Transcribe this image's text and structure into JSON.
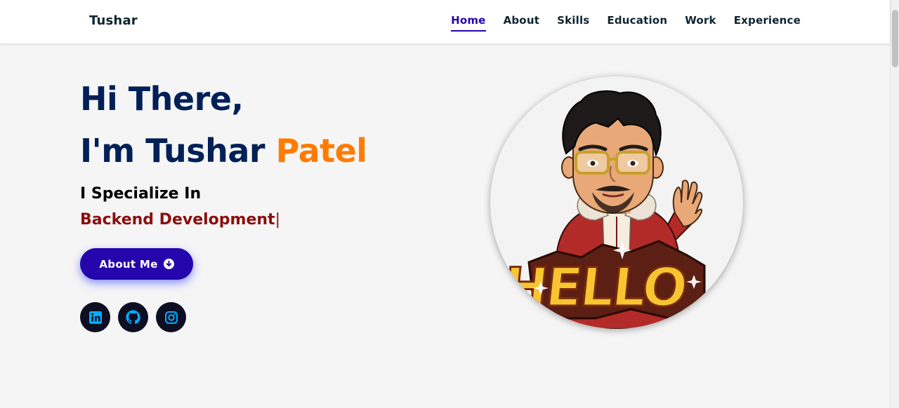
{
  "header": {
    "logo": "Tushar",
    "nav": [
      {
        "label": "Home",
        "active": true
      },
      {
        "label": "About"
      },
      {
        "label": "Skills"
      },
      {
        "label": "Education"
      },
      {
        "label": "Work"
      },
      {
        "label": "Experience"
      }
    ]
  },
  "hero": {
    "greeting": "Hi There,",
    "intro": "I'm Tushar ",
    "surname": "Patel",
    "specialize_label": "I Specialize In",
    "typed_text": "Backend Development",
    "typed_cursor": "|",
    "about_button": {
      "label": "About Me",
      "icon": "arrow-down-circle-icon"
    },
    "socials": [
      {
        "name": "linkedin-icon"
      },
      {
        "name": "github-icon"
      },
      {
        "name": "instagram-icon"
      }
    ],
    "avatar": {
      "name": "bitmoji-avatar",
      "sign_text": "HELLO"
    }
  },
  "colors": {
    "primary": "#2506ad",
    "heading": "#002057",
    "accent": "#ff7b00",
    "typed": "#8b0f0f",
    "social_icon": "#00aeff"
  }
}
